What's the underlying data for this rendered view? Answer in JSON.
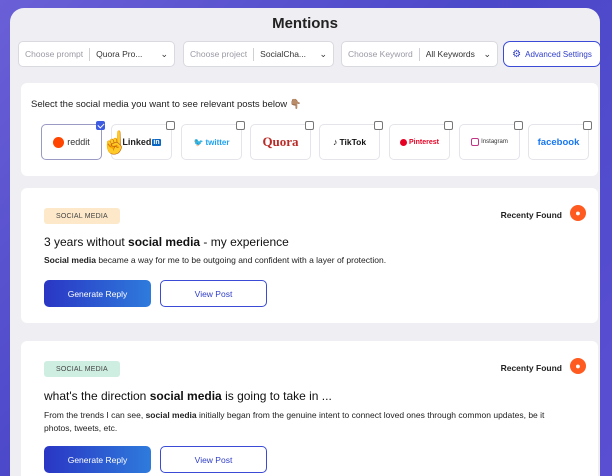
{
  "header": {
    "title": "Mentions"
  },
  "filters": {
    "prompt": {
      "placeholder": "Choose prompt",
      "value": "Quora Pro..."
    },
    "project": {
      "placeholder": "Choose project",
      "value": "SocialCha..."
    },
    "keyword": {
      "placeholder": "Choose Keyword",
      "value": "All Keywords"
    },
    "advanced_label": "Advanced Settings"
  },
  "social": {
    "prompt": "Select the social media you want to see relevant posts below 👇🏽",
    "platforms": [
      {
        "label": "reddit",
        "checked": true,
        "color": "#ff4500"
      },
      {
        "label": "Linked",
        "suffix": "in",
        "checked": false,
        "color": "#0a66c2"
      },
      {
        "label": "twitter",
        "checked": false,
        "color": "#1da1f2"
      },
      {
        "label": "Quora",
        "checked": false,
        "color": "#b92b27"
      },
      {
        "label": "TikTok",
        "checked": false,
        "color": "#000000"
      },
      {
        "label": "Pinterest",
        "checked": false,
        "color": "#e60023"
      },
      {
        "label": "Instagram",
        "checked": false,
        "color": "#c13584"
      },
      {
        "label": "facebook",
        "checked": false,
        "color": "#1877f2"
      }
    ]
  },
  "posts": [
    {
      "tag": "SOCIAL MEDIA",
      "status": "Recenty Found",
      "title_pre": "3 years without ",
      "title_bold": "social media",
      "title_post": " - my experience",
      "body_bold": "Social media",
      "body_post": " became a way for me to be outgoing and confident with a layer of protection.",
      "generate_label": "Generate Reply",
      "view_label": "View Post"
    },
    {
      "tag": "SOCIAL MEDIA",
      "status": "Recenty Found",
      "title_pre": "what's the direction ",
      "title_bold": "social media",
      "title_post": " is going to take in ...",
      "body_pre": "From the trends I can see, ",
      "body_bold": "social media",
      "body_post": " initially began from the genuine intent to connect loved ones through common updates, be it photos, tweets, etc.",
      "generate_label": "Generate Reply",
      "view_label": "View Post"
    }
  ]
}
